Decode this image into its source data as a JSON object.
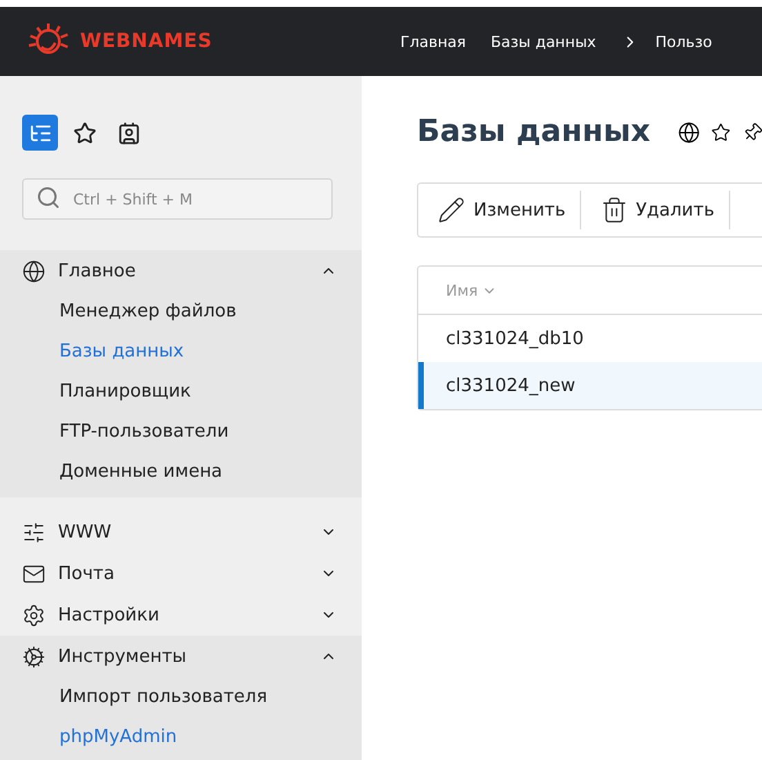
{
  "header": {
    "logo": "WEBNAMES",
    "breadcrumbs": [
      {
        "label": "Главная",
        "separator_before": false
      },
      {
        "label": "Базы данных",
        "separator_before": false
      },
      {
        "label": "Пользо",
        "separator_before": true
      }
    ]
  },
  "sidebar": {
    "tabs": [
      {
        "kind": "tree",
        "selected": true
      },
      {
        "kind": "star",
        "selected": false
      },
      {
        "kind": "badge",
        "selected": false
      }
    ],
    "search": {
      "placeholder": "Ctrl + Shift + M"
    },
    "groups": [
      {
        "label": "Главное",
        "expanded": true,
        "items": [
          {
            "label": "Менеджер файлов",
            "selected": false
          },
          {
            "label": "Базы данных",
            "selected": true
          },
          {
            "label": "Планировщик",
            "selected": false
          },
          {
            "label": "FTP-пользователи",
            "selected": false
          },
          {
            "label": "Доменные имена",
            "selected": false
          }
        ]
      },
      {
        "label": "WWW",
        "expanded": false
      },
      {
        "label": "Почта",
        "expanded": false
      },
      {
        "label": "Настройки",
        "expanded": false
      },
      {
        "label": "Инструменты",
        "expanded": true,
        "items": [
          {
            "label": "Импорт пользователя",
            "selected": false
          },
          {
            "label": "phpMyAdmin",
            "selected": true
          }
        ]
      }
    ]
  },
  "main": {
    "title": "Базы данных",
    "toolbar": [
      {
        "label": "Изменить"
      },
      {
        "label": "Удалить"
      }
    ],
    "table": {
      "columns": [
        {
          "label": "Имя",
          "sorted": true
        }
      ],
      "rows": [
        {
          "name": "cl331024_db10",
          "selected": false
        },
        {
          "name": "cl331024_new",
          "selected": true
        }
      ]
    }
  }
}
